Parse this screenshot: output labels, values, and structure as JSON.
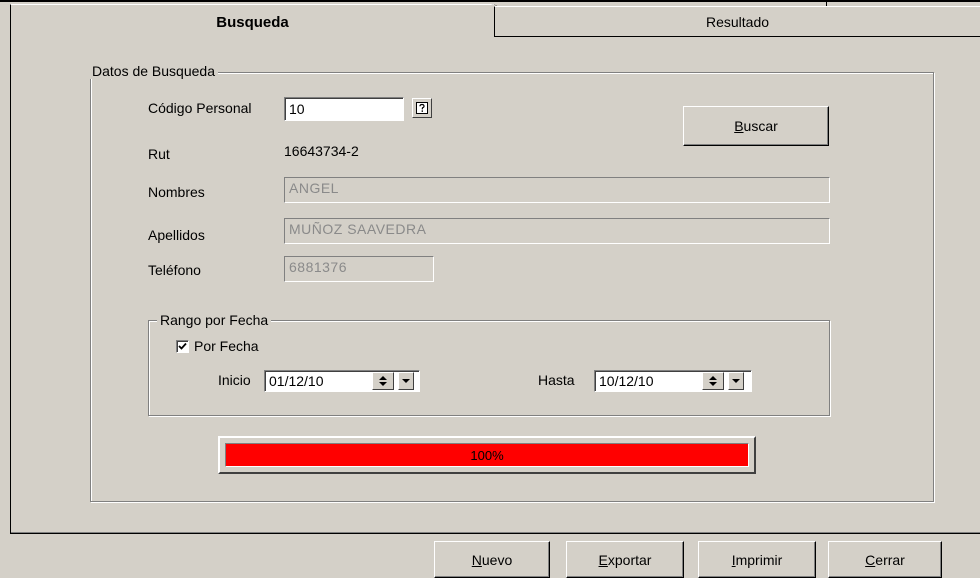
{
  "tabs": [
    {
      "label": "Busqueda",
      "active": true
    },
    {
      "label": "Resultado",
      "active": false
    }
  ],
  "search_group": {
    "legend": "Datos de Busqueda",
    "codigo_label": "Código Personal",
    "codigo_value": "10",
    "rut_label": "Rut",
    "rut_value": "16643734-2",
    "nombres_label": "Nombres",
    "nombres_value": "ANGEL",
    "apellidos_label": "Apellidos",
    "apellidos_value": "MUÑOZ SAAVEDRA",
    "telefono_label": "Teléfono",
    "telefono_value": "6881376",
    "buscar_button": {
      "accel": "B",
      "rest": "uscar"
    }
  },
  "date_group": {
    "legend": "Rango por Fecha",
    "por_fecha_label": "Por Fecha",
    "por_fecha_checked": true,
    "inicio_label": "Inicio",
    "inicio_value": "01/12/10",
    "hasta_label": "Hasta",
    "hasta_value": "10/12/10"
  },
  "progress": {
    "percent": 100,
    "text": "100%",
    "fill_color": "#ff0000"
  },
  "footer_buttons": [
    {
      "accel": "N",
      "rest": "uevo"
    },
    {
      "accel": "E",
      "rest": "xportar"
    },
    {
      "accel": "I",
      "rest": "mprimir"
    },
    {
      "accel": "C",
      "rest": "errar"
    }
  ],
  "icons": {
    "help": "help-question-icon",
    "check": "checkmark-icon"
  }
}
